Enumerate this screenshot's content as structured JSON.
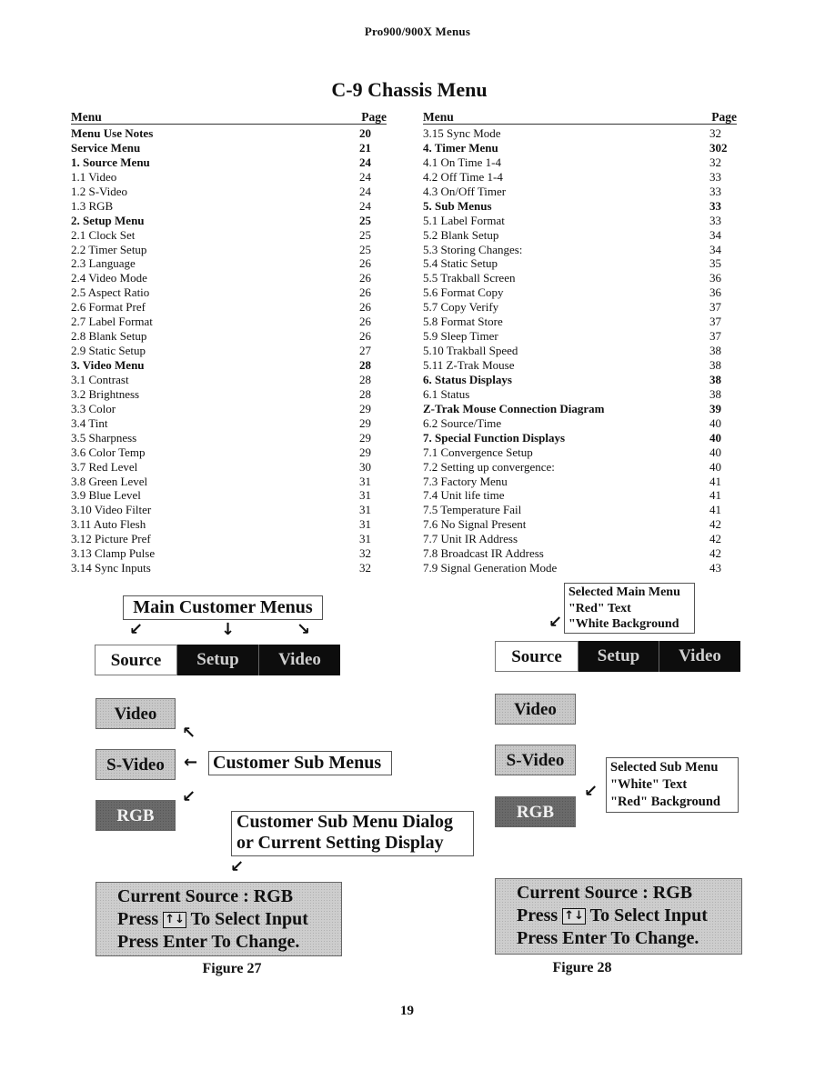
{
  "header": {
    "title": "Pro900/900X  Menus"
  },
  "main_title": "C-9 Chassis  Menu",
  "toc": {
    "column_header": {
      "menu": "Menu",
      "page": "Page"
    },
    "left": [
      {
        "label": "Menu Use Notes",
        "page": "20",
        "bold": true
      },
      {
        "label": "Service Menu",
        "page": "21",
        "bold": true
      },
      {
        "label": "1. Source Menu",
        "page": "24",
        "bold": true
      },
      {
        "label": "1.1 Video",
        "page": "24",
        "bold": false
      },
      {
        "label": "1.2 S-Video",
        "page": "24",
        "bold": false
      },
      {
        "label": "1.3 RGB",
        "page": "24",
        "bold": false
      },
      {
        "label": "2. Setup Menu",
        "page": "25",
        "bold": true
      },
      {
        "label": "2.1 Clock Set",
        "page": "25",
        "bold": false
      },
      {
        "label": "2.2 Timer Setup",
        "page": "25",
        "bold": false
      },
      {
        "label": "2.3 Language",
        "page": "26",
        "bold": false
      },
      {
        "label": "2.4 Video Mode",
        "page": "26",
        "bold": false
      },
      {
        "label": "2.5 Aspect Ratio",
        "page": "26",
        "bold": false
      },
      {
        "label": "2.6 Format Pref",
        "page": "26",
        "bold": false
      },
      {
        "label": "2.7 Label Format",
        "page": "26",
        "bold": false
      },
      {
        "label": "2.8 Blank Setup",
        "page": "26",
        "bold": false
      },
      {
        "label": "2.9 Static Setup",
        "page": "27",
        "bold": false
      },
      {
        "label": "3. Video Menu",
        "page": "28",
        "bold": true
      },
      {
        "label": "3.1 Contrast",
        "page": "28",
        "bold": false
      },
      {
        "label": "3.2 Brightness",
        "page": "28",
        "bold": false
      },
      {
        "label": "3.3 Color",
        "page": "29",
        "bold": false
      },
      {
        "label": "3.4 Tint",
        "page": "29",
        "bold": false
      },
      {
        "label": "3.5 Sharpness",
        "page": "29",
        "bold": false
      },
      {
        "label": "3.6 Color Temp",
        "page": "29",
        "bold": false
      },
      {
        "label": "3.7 Red Level",
        "page": "30",
        "bold": false
      },
      {
        "label": "3.8 Green Level",
        "page": "31",
        "bold": false
      },
      {
        "label": "3.9 Blue Level",
        "page": "31",
        "bold": false
      },
      {
        "label": "3.10 Video Filter",
        "page": "31",
        "bold": false
      },
      {
        "label": "3.11 Auto Flesh",
        "page": "31",
        "bold": false
      },
      {
        "label": "3.12 Picture Pref",
        "page": "31",
        "bold": false
      },
      {
        "label": "3.13 Clamp Pulse",
        "page": "32",
        "bold": false
      },
      {
        "label": "3.14 Sync Inputs",
        "page": "32",
        "bold": false
      }
    ],
    "right": [
      {
        "label": "3.15 Sync Mode",
        "page": "32",
        "bold": false
      },
      {
        "label": "4. Timer Menu",
        "page": "302",
        "bold": true
      },
      {
        "label": "4.1 On Time 1-4",
        "page": "32",
        "bold": false
      },
      {
        "label": "4.2 Off Time 1-4",
        "page": "33",
        "bold": false
      },
      {
        "label": "4.3 On/Off Timer",
        "page": "33",
        "bold": false
      },
      {
        "label": "5. Sub Menus",
        "page": "33",
        "bold": true
      },
      {
        "label": "5.1 Label Format",
        "page": "33",
        "bold": false
      },
      {
        "label": "5.2 Blank Setup",
        "page": "34",
        "bold": false
      },
      {
        "label": "5.3 Storing Changes:",
        "page": "34",
        "bold": false
      },
      {
        "label": "5.4 Static Setup",
        "page": "35",
        "bold": false
      },
      {
        "label": "5.5 Trakball Screen",
        "page": "36",
        "bold": false
      },
      {
        "label": "5.6 Format Copy",
        "page": "36",
        "bold": false
      },
      {
        "label": "5.7 Copy Verify",
        "page": "37",
        "bold": false
      },
      {
        "label": "5.8 Format Store",
        "page": "37",
        "bold": false
      },
      {
        "label": "5.9 Sleep Timer",
        "page": "37",
        "bold": false
      },
      {
        "label": "5.10 Trakball Speed",
        "page": "38",
        "bold": false
      },
      {
        "label": "5.11 Z-Trak Mouse",
        "page": "38",
        "bold": false
      },
      {
        "label": "6. Status Displays",
        "page": "38",
        "bold": true
      },
      {
        "label": "6.1 Status",
        "page": "38",
        "bold": false
      },
      {
        "label": "Z-Trak Mouse Connection Diagram",
        "page": "39",
        "bold": true
      },
      {
        "label": "6.2 Source/Time",
        "page": "40",
        "bold": false
      },
      {
        "label": "7. Special Function Displays",
        "page": "40",
        "bold": true
      },
      {
        "label": "7.1 Convergence Setup",
        "page": "40",
        "bold": false
      },
      {
        "label": "7.2 Setting up convergence:",
        "page": "40",
        "bold": false
      },
      {
        "label": "7.3 Factory Menu",
        "page": "41",
        "bold": false
      },
      {
        "label": "7.4 Unit life time",
        "page": "41",
        "bold": false
      },
      {
        "label": "7.5 Temperature Fail",
        "page": "41",
        "bold": false
      },
      {
        "label": "7.6 No Signal Present",
        "page": "42",
        "bold": false
      },
      {
        "label": "7.7 Unit IR Address",
        "page": "42",
        "bold": false
      },
      {
        "label": "7.8 Broadcast IR Address",
        "page": "42",
        "bold": false
      },
      {
        "label": "7.9 Signal Generation Mode",
        "page": "43",
        "bold": false
      }
    ]
  },
  "figure27": {
    "main_menus_callout": "Main Customer Menus",
    "main_menu": [
      "Source",
      "Setup",
      "Video"
    ],
    "sub_menu": [
      "Video",
      "S-Video",
      "RGB"
    ],
    "sub_menus_callout": "Customer Sub Menus",
    "dialog_callout": [
      "Customer Sub Menu Dialog",
      "or Current Setting Display"
    ],
    "status": {
      "line1": "Current  Source :   RGB",
      "line2_prefix": "Press",
      "line2_icon": "↑↓",
      "line2_suffix": "To Select Input",
      "line3": "Press Enter To Change."
    },
    "caption": "Figure 27"
  },
  "figure28": {
    "selected_main_callout": [
      "Selected Main Menu",
      "\"Red\" Text",
      "\"White Background"
    ],
    "main_menu": [
      "Source",
      "Setup",
      "Video"
    ],
    "sub_menu": [
      "Video",
      "S-Video",
      "RGB"
    ],
    "selected_sub_callout": [
      "Selected Sub Menu",
      "\"White\" Text",
      "\"Red\" Background"
    ],
    "status": {
      "line1": "Current  Source :   RGB",
      "line2_prefix": "Press",
      "line2_icon": "↑↓",
      "line2_suffix": "To Select Input",
      "line3": "Press Enter To Change."
    },
    "caption": "Figure 28"
  },
  "icons": {
    "arrow_down_left": "↙",
    "arrow_down": "↓",
    "arrow_down_right": "↘",
    "arrow_up_left": "↖",
    "arrow_left": "←"
  },
  "page_number": "19"
}
